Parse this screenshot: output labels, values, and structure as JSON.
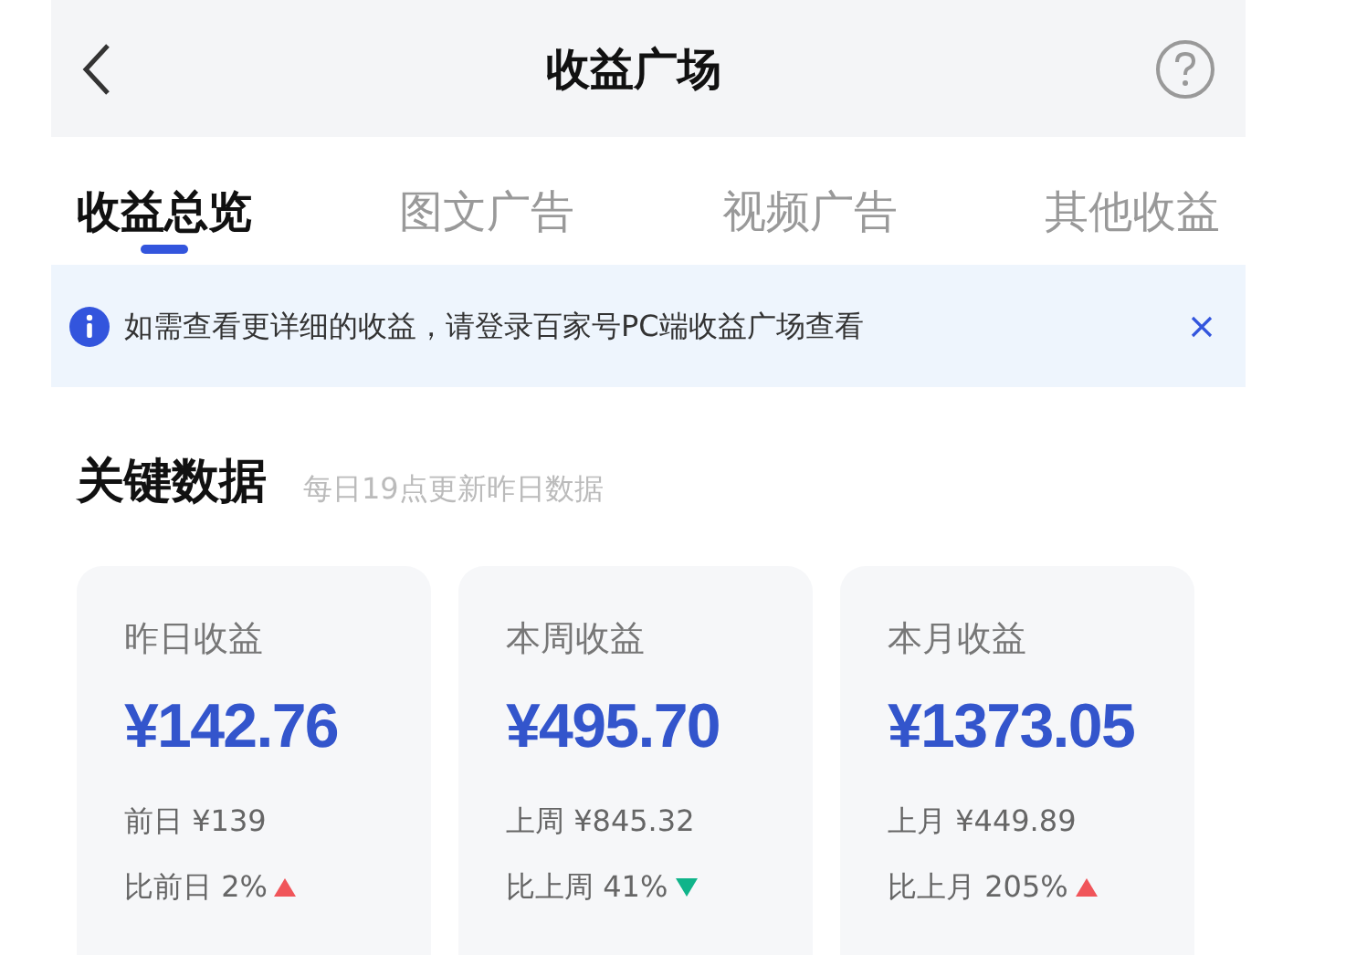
{
  "header": {
    "title": "收益广场"
  },
  "tabs": [
    {
      "label": "收益总览",
      "selected": true
    },
    {
      "label": "图文广告",
      "selected": false
    },
    {
      "label": "视频广告",
      "selected": false
    },
    {
      "label": "其他收益",
      "selected": false
    }
  ],
  "notice": {
    "text": "如需查看更详细的收益，请登录百家号PC端收益广场查看"
  },
  "key_data": {
    "title": "关键数据",
    "subtitle": "每日19点更新昨日数据",
    "cards": [
      {
        "label": "昨日收益",
        "amount": "¥142.76",
        "previous": "前日 ¥139",
        "change": "比前日 2%",
        "increase": true
      },
      {
        "label": "本周收益",
        "amount": "¥495.70",
        "previous": "上周 ¥845.32",
        "change": "比上周 41%",
        "increase": false
      },
      {
        "label": "本月收益",
        "amount": "¥1373.05",
        "previous": "上月 ¥449.89",
        "change": "比上月 205%",
        "increase": true
      }
    ]
  }
}
